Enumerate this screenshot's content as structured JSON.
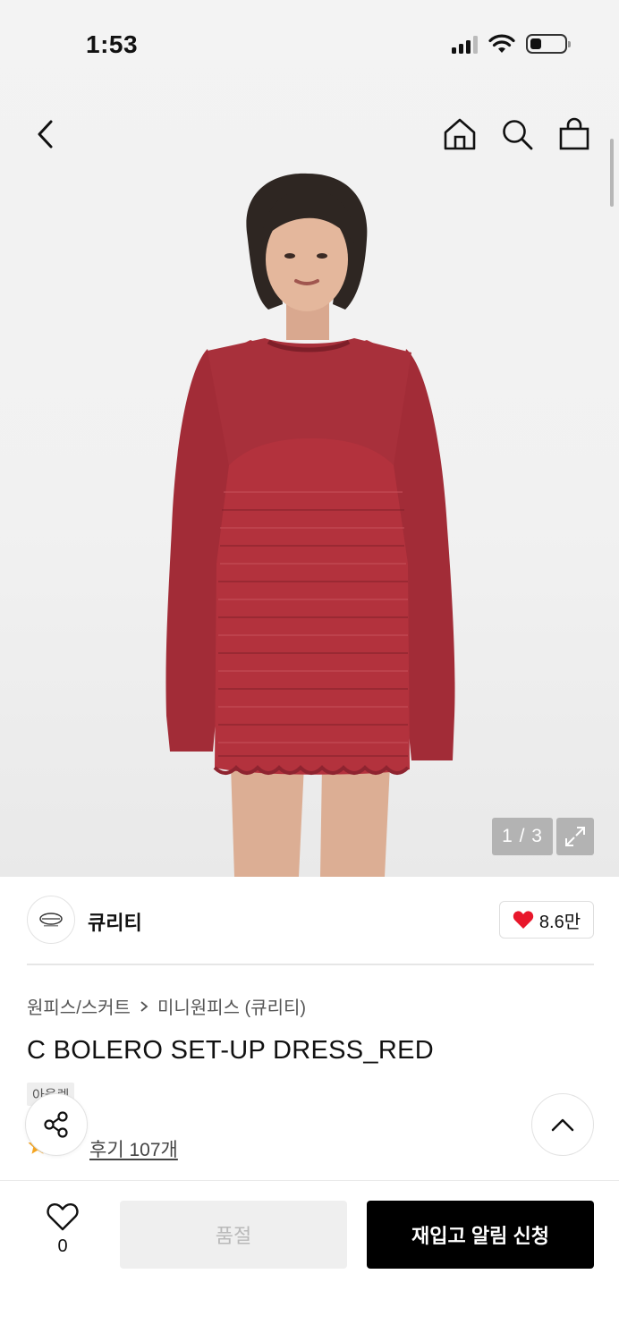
{
  "status_bar": {
    "time": "1:53"
  },
  "product_image": {
    "counter": "1 / 3"
  },
  "brand": {
    "name": "큐리티",
    "likes": "8.6만"
  },
  "breadcrumb": {
    "category": "원피스/스커트",
    "subcategory": "미니원피스 (큐리티)"
  },
  "product": {
    "title": "C BOLERO SET-UP DRESS_RED",
    "badge": "아울렛",
    "rating": "5",
    "reviews": "후기 107개"
  },
  "bottom_bar": {
    "wish_count": "0",
    "soldout_label": "품절",
    "restock_label": "재입고 알림 신청"
  },
  "colors": {
    "accent": "#000000",
    "heart": "#e8172b",
    "star": "#f5a623",
    "dress": "#b3323d"
  }
}
